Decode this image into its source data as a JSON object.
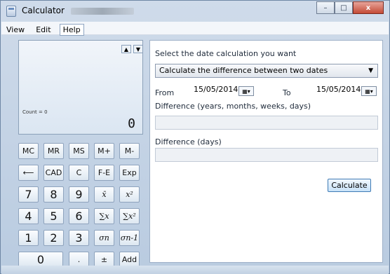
{
  "window": {
    "title": "Calculator",
    "buttons": {
      "minimize": "–",
      "maximize": "□",
      "close": "x"
    }
  },
  "menu": {
    "items": [
      "View",
      "Edit",
      "Help"
    ]
  },
  "calculator": {
    "display": {
      "count": "Count = 0",
      "value": "0"
    },
    "keys": [
      [
        "MC",
        "MR",
        "MS",
        "M+",
        "M-"
      ],
      [
        "⟵",
        "CAD",
        "C",
        "F-E",
        "Exp"
      ],
      [
        "7",
        "8",
        "9",
        "x̄",
        "x²"
      ],
      [
        "4",
        "5",
        "6",
        "∑x",
        "∑x²"
      ],
      [
        "1",
        "2",
        "3",
        "σn",
        "σn-1"
      ],
      [
        "0",
        ".",
        "±",
        "Add"
      ]
    ]
  },
  "date_panel": {
    "instruction": "Select the date calculation you want",
    "mode": "Calculate the difference between two dates",
    "from_label": "From",
    "to_label": "To",
    "from_date": "15/05/2014",
    "to_date": "15/05/2014",
    "difference_ymwd_label": "Difference (years, months, weeks, days)",
    "difference_days_label": "Difference (days)",
    "calculate_label": "Calculate"
  }
}
